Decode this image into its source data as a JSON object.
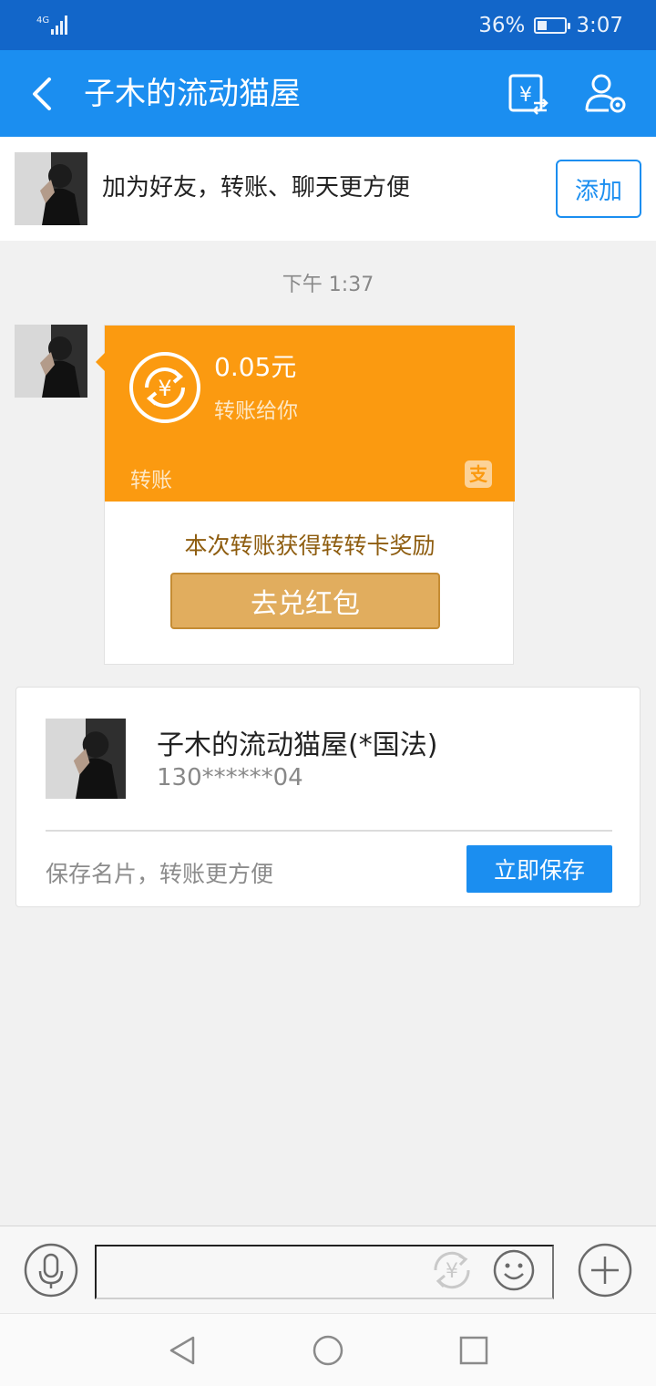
{
  "status_bar": {
    "network": "4G",
    "battery_percent": "36%",
    "battery_level": 0.36,
    "time": "3:07"
  },
  "header": {
    "title": "子木的流动猫屋",
    "icons": [
      "back-icon",
      "yuan-transfer-icon",
      "user-settings-icon"
    ]
  },
  "friend_bar": {
    "text": "加为好友，转账、聊天更方便",
    "add_label": "添加"
  },
  "chat": {
    "timestamp": "下午 1:37",
    "transfer": {
      "amount": "0.05元",
      "subtitle": "转账给你",
      "label": "转账",
      "brand_icon": "支",
      "reward_text": "本次转账获得转转卡奖励",
      "redeem_label": "去兑红包"
    }
  },
  "contact_card": {
    "name": "子木的流动猫屋(*国法)",
    "phone": "130******04",
    "hint": "保存名片，转账更方便",
    "save_label": "立即保存"
  },
  "input_bar": {
    "placeholder": "",
    "icons": [
      "microphone-icon",
      "yuan-icon",
      "emoji-icon",
      "plus-icon"
    ]
  },
  "nav_bar": {
    "icons": [
      "nav-back-icon",
      "nav-home-icon",
      "nav-recent-icon"
    ]
  },
  "colors": {
    "status_bar": "#1266c9",
    "header": "#1b8ef0",
    "transfer": "#fb9a10",
    "redeem_button": "#e1ad5e",
    "reward_text": "#8e5d10"
  }
}
